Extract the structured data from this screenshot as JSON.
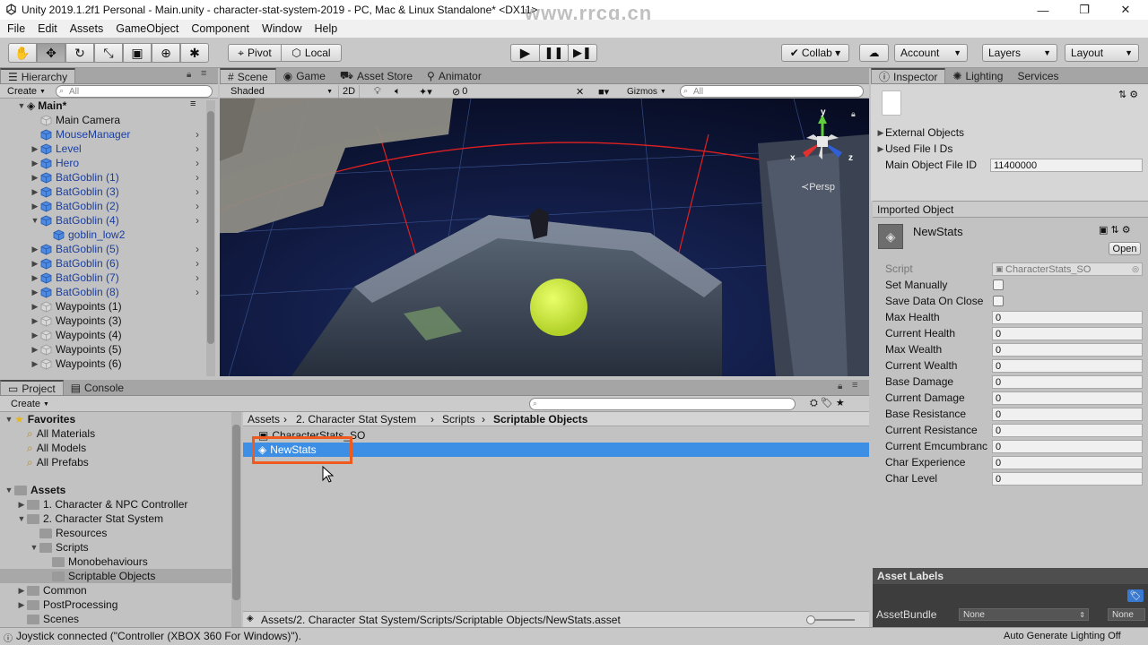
{
  "window": {
    "title": "Unity 2019.1.2f1 Personal - Main.unity - character-stat-system-2019 - PC, Mac & Linux Standalone* <DX11>",
    "watermark": "www.rrcg.cn",
    "min": "—",
    "max": "❐",
    "close": "✕"
  },
  "menu": [
    "File",
    "Edit",
    "Assets",
    "GameObject",
    "Component",
    "Window",
    "Help"
  ],
  "toolbar": {
    "pivot": "Pivot",
    "local": "Local",
    "collab": "Collab ▾",
    "account": "Account",
    "layers": "Layers",
    "layout": "Layout"
  },
  "hierarchy": {
    "tab": "Hierarchy",
    "create": "Create",
    "search_placeholder": "All",
    "root": "Main*",
    "items": [
      {
        "label": "Main Camera",
        "prefab": false,
        "arrow": "",
        "indent": 0
      },
      {
        "label": "MouseManager",
        "prefab": true,
        "arrow": "",
        "indent": 0
      },
      {
        "label": "Level",
        "prefab": true,
        "arrow": "▶",
        "indent": 0
      },
      {
        "label": "Hero",
        "prefab": true,
        "arrow": "▶",
        "indent": 0
      },
      {
        "label": "BatGoblin (1)",
        "prefab": true,
        "arrow": "▶",
        "indent": 0
      },
      {
        "label": "BatGoblin (3)",
        "prefab": true,
        "arrow": "▶",
        "indent": 0
      },
      {
        "label": "BatGoblin (2)",
        "prefab": true,
        "arrow": "▶",
        "indent": 0
      },
      {
        "label": "BatGoblin (4)",
        "prefab": true,
        "arrow": "▼",
        "indent": 0
      },
      {
        "label": "goblin_low2",
        "prefab": true,
        "arrow": "",
        "indent": 1
      },
      {
        "label": "BatGoblin (5)",
        "prefab": true,
        "arrow": "▶",
        "indent": 0
      },
      {
        "label": "BatGoblin (6)",
        "prefab": true,
        "arrow": "▶",
        "indent": 0
      },
      {
        "label": "BatGoblin (7)",
        "prefab": true,
        "arrow": "▶",
        "indent": 0
      },
      {
        "label": "BatGoblin (8)",
        "prefab": true,
        "arrow": "▶",
        "indent": 0
      },
      {
        "label": "Waypoints (1)",
        "prefab": false,
        "arrow": "▶",
        "indent": 0
      },
      {
        "label": "Waypoints (3)",
        "prefab": false,
        "arrow": "▶",
        "indent": 0
      },
      {
        "label": "Waypoints (4)",
        "prefab": false,
        "arrow": "▶",
        "indent": 0
      },
      {
        "label": "Waypoints (5)",
        "prefab": false,
        "arrow": "▶",
        "indent": 0
      },
      {
        "label": "Waypoints (6)",
        "prefab": false,
        "arrow": "▶",
        "indent": 0
      }
    ]
  },
  "scene": {
    "tabs": [
      "Scene",
      "Game",
      "Asset Store",
      "Animator"
    ],
    "shading": "Shaded",
    "mode_2d": "2D",
    "fx_count": "0",
    "gizmos": "Gizmos",
    "search_placeholder": "All",
    "persp": "Persp",
    "axis_x": "x",
    "axis_y": "y",
    "axis_z": "z"
  },
  "project": {
    "tabs": [
      "Project",
      "Console"
    ],
    "create": "Create",
    "favorites_label": "Favorites",
    "favorites": [
      "All Materials",
      "All Models",
      "All Prefabs"
    ],
    "assets_label": "Assets",
    "tree": [
      {
        "label": "1. Character & NPC Controller",
        "arrow": "▶",
        "indent": 1,
        "selected": false
      },
      {
        "label": "2. Character Stat System",
        "arrow": "▼",
        "indent": 1,
        "selected": false
      },
      {
        "label": "Resources",
        "arrow": "",
        "indent": 2,
        "selected": false
      },
      {
        "label": "Scripts",
        "arrow": "▼",
        "indent": 2,
        "selected": false
      },
      {
        "label": "Monobehaviours",
        "arrow": "",
        "indent": 3,
        "selected": false
      },
      {
        "label": "Scriptable Objects",
        "arrow": "",
        "indent": 3,
        "selected": true
      },
      {
        "label": "Common",
        "arrow": "▶",
        "indent": 1,
        "selected": false
      },
      {
        "label": "PostProcessing",
        "arrow": "▶",
        "indent": 1,
        "selected": false
      },
      {
        "label": "Scenes",
        "arrow": "",
        "indent": 1,
        "selected": false
      }
    ],
    "breadcrumb": [
      "Assets",
      "2. Character Stat System",
      "Scripts",
      "Scriptable Objects"
    ],
    "files": [
      "CharacterStats_SO",
      "NewStats"
    ],
    "path": "Assets/2. Character Stat System/Scripts/Scriptable Objects/NewStats.asset"
  },
  "inspector": {
    "tabs": [
      "Inspector",
      "Lighting",
      "Services"
    ],
    "external_objects": "External Objects",
    "used_file_ids": "Used File I Ds",
    "main_object_file_id_label": "Main Object File ID",
    "main_object_file_id": "11400000",
    "imported_object": "Imported Object",
    "object_name": "NewStats",
    "open": "Open",
    "script_label": "Script",
    "script_value": "CharacterStats_SO",
    "checkboxes": [
      "Set Manually",
      "Save Data On Close"
    ],
    "fields": [
      {
        "label": "Max Health",
        "value": "0"
      },
      {
        "label": "Current Health",
        "value": "0"
      },
      {
        "label": "Max Wealth",
        "value": "0"
      },
      {
        "label": "Current Wealth",
        "value": "0"
      },
      {
        "label": "Base Damage",
        "value": "0"
      },
      {
        "label": "Current Damage",
        "value": "0"
      },
      {
        "label": "Base Resistance",
        "value": "0"
      },
      {
        "label": "Current Resistance",
        "value": "0"
      },
      {
        "label": "Current Emcumbranc",
        "value": "0"
      },
      {
        "label": "Char Experience",
        "value": "0"
      },
      {
        "label": "Char Level",
        "value": "0"
      }
    ],
    "asset_labels": "Asset Labels",
    "asset_bundle_label": "AssetBundle",
    "asset_bundle_value": "None",
    "asset_variant_value": "None"
  },
  "status": {
    "message": "Joystick connected (\"Controller (XBOX 360 For Windows)\").",
    "lighting": "Auto Generate Lighting Off"
  }
}
